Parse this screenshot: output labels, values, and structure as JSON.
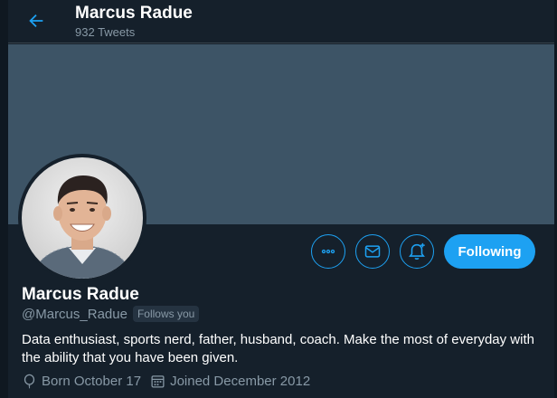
{
  "header": {
    "title": "Marcus Radue",
    "tweet_count": "932 Tweets",
    "back_icon": "arrow-left-icon"
  },
  "colors": {
    "background": "#15202b",
    "banner": "#3d5466",
    "accent": "#1da1f2",
    "muted_text": "#8899a6"
  },
  "profile": {
    "name": "Marcus Radue",
    "handle": "@Marcus_Radue",
    "follows_you": "Follows you",
    "bio": "Data enthusiast, sports nerd, father, husband, coach. Make the most of everyday with the ability that you have been given.",
    "born": "Born October 17",
    "joined": "Joined December 2012"
  },
  "actions": {
    "more_icon": "more-horizontal-icon",
    "message_icon": "envelope-icon",
    "notify_icon": "bell-plus-icon",
    "following_label": "Following"
  }
}
